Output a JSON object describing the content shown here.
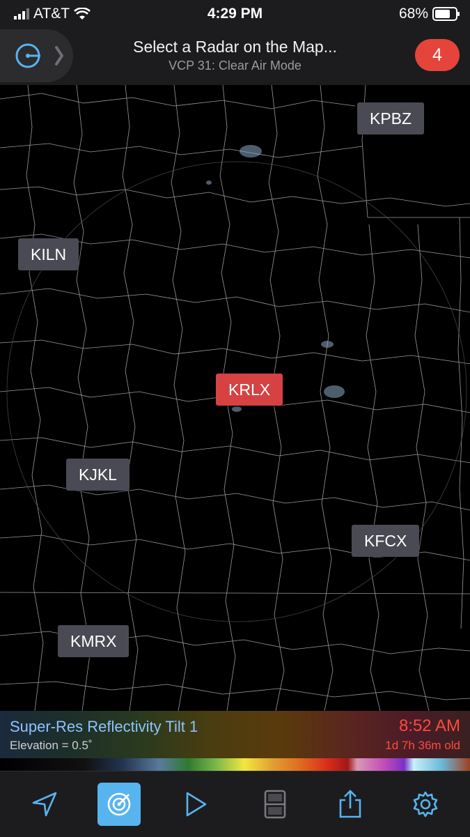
{
  "status_bar": {
    "carrier": "AT&T",
    "time": "4:29 PM",
    "battery": "68%"
  },
  "header": {
    "title": "Select a Radar on the Map...",
    "subtitle": "VCP 31: Clear Air Mode",
    "badge": "4"
  },
  "radar_sites": {
    "kpbz": "KPBZ",
    "kiln": "KILN",
    "krlx": "KRLX",
    "kjkl": "KJKL",
    "kfcx": "KFCX",
    "kmrx": "KMRX"
  },
  "legend": {
    "product": "Super-Res Reflectivity Tilt 1",
    "elevation": "Elevation = 0.5˚",
    "scan_time": "8:52 AM",
    "age": "1d 7h 36m old"
  },
  "colors": {
    "accent": "#58b4ef",
    "selected_site": "#d64242",
    "site": "#4a4a54",
    "badge": "#e5443b",
    "alert_text": "#ff4a3c"
  },
  "toolbar_icons": [
    "location-arrow-icon",
    "radar-icon",
    "play-icon",
    "layout-icon",
    "share-icon",
    "gear-icon"
  ]
}
